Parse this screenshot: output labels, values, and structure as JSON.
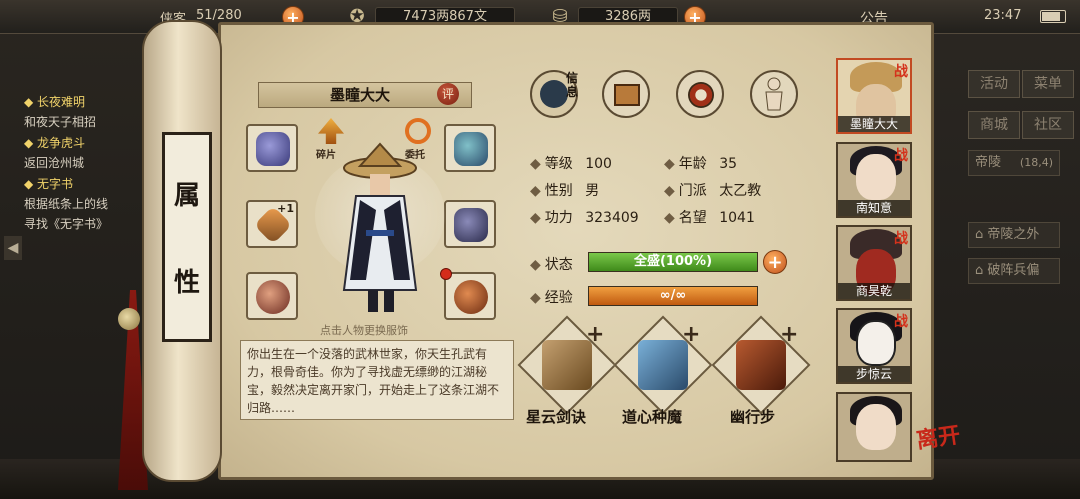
{
  "topbar": {
    "partial_label": "侠客",
    "count": "51/280",
    "money_copper": "7473两867文",
    "money_silver": "3286两",
    "announce": "公告",
    "time": "23:47"
  },
  "quests": [
    {
      "title": "长夜难明",
      "desc": "和夜天子相招"
    },
    {
      "title": "龙争虎斗",
      "desc": "返回沧州城"
    },
    {
      "title": "无字书",
      "desc": "根据纸条上的线",
      "desc2": "寻找《无字书》"
    }
  ],
  "right_menu": {
    "buttons": [
      "活动",
      "菜单",
      "商城",
      "社区"
    ],
    "location": "帝陵",
    "location_coord": "(18,4)",
    "items": [
      "帝陵之外",
      "破阵兵偏"
    ]
  },
  "scroll_label": [
    "属",
    "性"
  ],
  "character": {
    "name": "墨瞳大大",
    "rate": "评",
    "hint": "点击人物更换服饰",
    "shard_label": "碎片",
    "delegate_label": "委托",
    "slot_plus": "+1",
    "bio": "你出生在一个没落的武林世家，你天生孔武有力，根骨奇佳。你为了寻找虚无缥缈的江湖秘宝，毅然决定离开家门，开始走上了这条江湖不归路……"
  },
  "tabs": {
    "info_label": "信息"
  },
  "stats": {
    "level_label": "等级",
    "level": "100",
    "age_label": "年龄",
    "age": "35",
    "gender_label": "性别",
    "gender": "男",
    "sect_label": "门派",
    "sect": "太乙教",
    "power_label": "功力",
    "power": "323409",
    "fame_label": "名望",
    "fame": "1041",
    "status_label": "状态",
    "status": "全盛(100%)",
    "status_fill": 1.0,
    "exp_label": "经验",
    "exp": "∞/∞",
    "exp_fill": 1.0
  },
  "skills": [
    {
      "name": "星云剑诀",
      "plus": "+"
    },
    {
      "name": "道心种魔",
      "plus": "+"
    },
    {
      "name": "幽行步",
      "plus": "+"
    }
  ],
  "roster": [
    {
      "name": "墨瞳大大",
      "tag": "战"
    },
    {
      "name": "南知意",
      "tag": "战"
    },
    {
      "name": "商昊乾",
      "tag": "战"
    },
    {
      "name": "步惊云",
      "tag": "战"
    },
    {
      "name": "",
      "tag": ""
    }
  ],
  "leave_label": "离开",
  "colors": {
    "status_bar": "#5aa82a",
    "exp_bar": "#e07a1a",
    "accent_red": "#c8281a"
  }
}
